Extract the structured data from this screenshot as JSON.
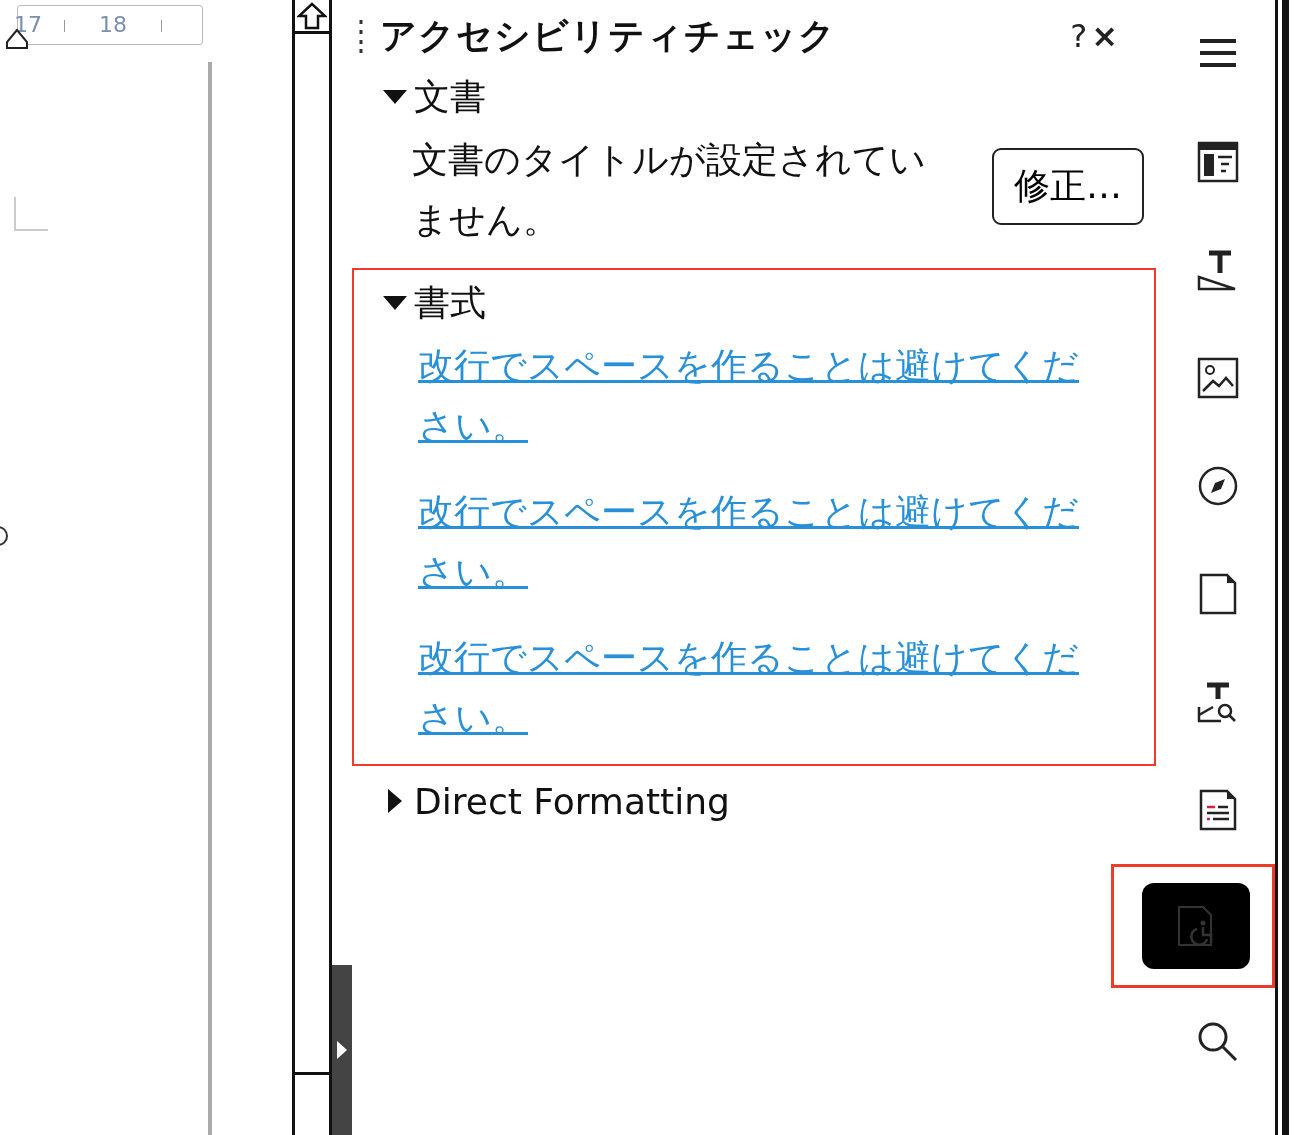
{
  "ruler": {
    "labels": [
      "17",
      "18"
    ]
  },
  "panel": {
    "title": "アクセシビリティチェック",
    "help": "?",
    "close": "×",
    "sections": [
      {
        "title": "文書",
        "expanded": true,
        "highlighted": false,
        "issues": [
          {
            "kind": "text",
            "text": "文書のタイトルが設定されていません。",
            "button": "修正…"
          }
        ]
      },
      {
        "title": "書式",
        "expanded": true,
        "highlighted": true,
        "issues": [
          {
            "kind": "link",
            "text": "改行でスペースを作ることは避けてください。"
          },
          {
            "kind": "link",
            "text": "改行でスペースを作ることは避けてください。"
          },
          {
            "kind": "link",
            "text": "改行でスペースを作ることは避けてください。"
          }
        ]
      },
      {
        "title": "Direct Formatting",
        "expanded": false,
        "highlighted": false
      }
    ]
  },
  "deck_tabs": [
    {
      "kind": "menu",
      "selected": false,
      "highlighted": false
    },
    {
      "kind": "properties",
      "selected": false,
      "highlighted": false
    },
    {
      "kind": "styles",
      "selected": false,
      "highlighted": false
    },
    {
      "kind": "gallery",
      "selected": false,
      "highlighted": false
    },
    {
      "kind": "navigator",
      "selected": false,
      "highlighted": false
    },
    {
      "kind": "page",
      "selected": false,
      "highlighted": false
    },
    {
      "kind": "style-inspector",
      "selected": false,
      "highlighted": false
    },
    {
      "kind": "changes",
      "selected": false,
      "highlighted": false
    },
    {
      "kind": "accessibility",
      "selected": true,
      "highlighted": true
    },
    {
      "kind": "find",
      "selected": false,
      "highlighted": false
    }
  ]
}
